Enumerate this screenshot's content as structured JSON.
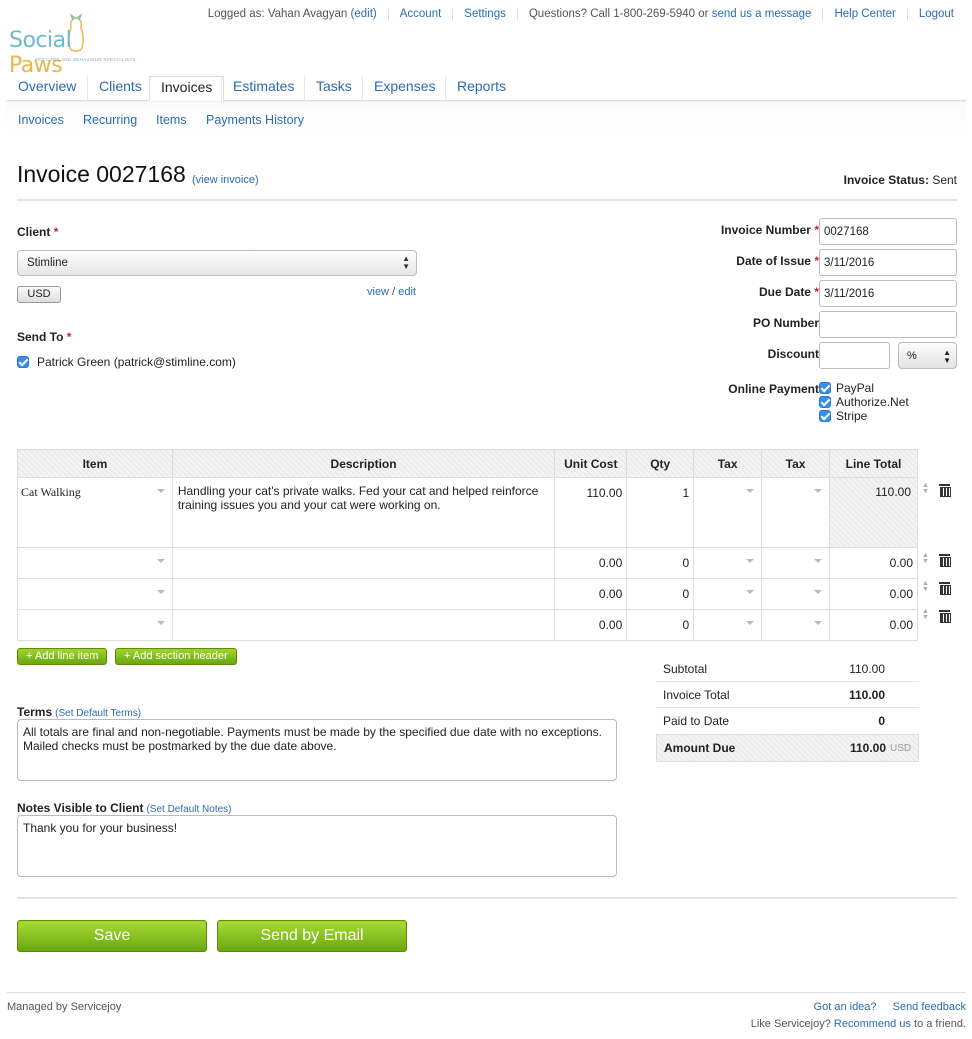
{
  "header": {
    "logged_as_prefix": "Logged as:",
    "user_name": "Vahan Avagyan",
    "edit_label": "(edit)",
    "account": "Account",
    "settings": "Settings",
    "questions_text": "Questions? Call 1-800-269-5940 or",
    "send_message": "send us a message",
    "help_center": "Help Center",
    "logout": "Logout"
  },
  "logo": {
    "part1": "Social",
    "part2": "Paws",
    "tagline": "PET CARE AND BEHAVIOUR SPECIALISTS"
  },
  "main_nav": [
    "Overview",
    "Clients",
    "Invoices",
    "Estimates",
    "Tasks",
    "Expenses",
    "Reports"
  ],
  "sub_nav": [
    "Invoices",
    "Recurring",
    "Items",
    "Payments History"
  ],
  "invoice": {
    "title": "Invoice 0027168",
    "view_link": "(view invoice)",
    "status_label": "Invoice Status:",
    "status_value": "Sent"
  },
  "client": {
    "label": "Client",
    "selected": "Stimline",
    "currency": "USD",
    "view": "view",
    "slash": "/",
    "edit": "edit"
  },
  "send_to": {
    "label": "Send To",
    "recipient": "Patrick Green (patrick@stimline.com)"
  },
  "fields": {
    "invoice_number_label": "Invoice Number",
    "invoice_number": "0027168",
    "date_issue_label": "Date of Issue",
    "date_issue": "3/11/2016",
    "due_date_label": "Due Date",
    "due_date": "3/11/2016",
    "po_label": "PO Number",
    "po": "",
    "discount_label": "Discount",
    "discount": "",
    "discount_type": "%",
    "online_payment_label": "Online Payment",
    "payment_methods": [
      "PayPal",
      "Authorize.Net",
      "Stripe"
    ]
  },
  "table": {
    "headers": [
      "Item",
      "Description",
      "Unit Cost",
      "Qty",
      "Tax",
      "Tax",
      "Line Total"
    ],
    "rows": [
      {
        "item": "Cat Walking",
        "description": "Handling your cat's private walks. Fed your cat and helped reinforce training issues you and your cat were working on.",
        "unit_cost": "110.00",
        "qty": "1",
        "line_total": "110.00"
      },
      {
        "item": "",
        "description": "",
        "unit_cost": "0.00",
        "qty": "0",
        "line_total": "0.00"
      },
      {
        "item": "",
        "description": "",
        "unit_cost": "0.00",
        "qty": "0",
        "line_total": "0.00"
      },
      {
        "item": "",
        "description": "",
        "unit_cost": "0.00",
        "qty": "0",
        "line_total": "0.00"
      }
    ]
  },
  "actions": {
    "add_line": "+ Add line item",
    "add_section": "+ Add section header"
  },
  "totals": {
    "subtotal_label": "Subtotal",
    "subtotal": "110.00",
    "invoice_total_label": "Invoice Total",
    "invoice_total": "110.00",
    "paid_label": "Paid to Date",
    "paid": "0",
    "amount_due_label": "Amount Due",
    "amount_due": "110.00",
    "currency": "USD"
  },
  "terms": {
    "label": "Terms",
    "set_default": "(Set Default Terms)",
    "text": "All totals are final and non-negotiable. Payments must be made by the specified due date with no exceptions. Mailed checks must be postmarked by the due date above."
  },
  "notes": {
    "label": "Notes Visible to Client",
    "set_default": "(Set Default Notes)",
    "text": "Thank you for your business!"
  },
  "buttons": {
    "save": "Save",
    "send_email": "Send by Email"
  },
  "footer": {
    "managed": "Managed by Servicejoy",
    "got_idea": "Got an idea?",
    "send_feedback": "Send feedback",
    "like_prefix": "Like Servicejoy?",
    "recommend": "Recommend us",
    "like_suffix": "to a friend."
  }
}
